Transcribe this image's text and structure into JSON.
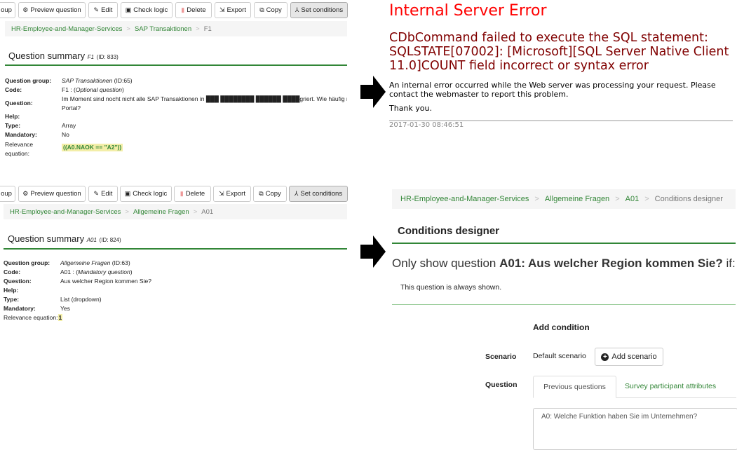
{
  "toolbar": {
    "group": "oup",
    "preview": "Preview question",
    "edit": "Edit",
    "check": "Check logic",
    "delete": "Delete",
    "export": "Export",
    "copy": "Copy",
    "set_conditions": "Set conditions"
  },
  "panel1": {
    "breadcrumb": [
      "HR-Employee-and-Manager-Services",
      "SAP Transaktionen",
      "F1"
    ],
    "title": "Question summary",
    "code": "F1",
    "id": "(ID: 833)",
    "rows": [
      {
        "label": "Question group:",
        "value": "SAP Transaktionen",
        "extra": " (ID:65)"
      },
      {
        "label": "Code:",
        "value": "F1 : (",
        "extra": "Optional question",
        "tail": ")"
      },
      {
        "label": "Question:",
        "value": "Im Moment sind nocht nicht alle SAP Transaktionen in ███ ████████ ██████ ████griert. Wie häufig nu",
        "line2": "Portal?"
      },
      {
        "label": "Help:",
        "value": ""
      },
      {
        "label": "Type:",
        "value": "Array"
      },
      {
        "label": "Mandatory:",
        "value": "No"
      },
      {
        "label": "Relevance equation:",
        "value": "((A0.NAOK == \"A2\"))"
      }
    ]
  },
  "panel2": {
    "breadcrumb": [
      "HR-Employee-and-Manager-Services",
      "Allgemeine Fragen",
      "A01"
    ],
    "title": "Question summary",
    "code": "A01",
    "id": "(ID: 824)",
    "rows": [
      {
        "label": "Question group:",
        "value": "Allgemeine Fragen",
        "extra": " (ID:63)"
      },
      {
        "label": "Code:",
        "value": "A01 : (",
        "extra": "Mandatory question",
        "tail": ")"
      },
      {
        "label": "Question:",
        "value": "Aus welcher Region kommen Sie?"
      },
      {
        "label": "Help:",
        "value": ""
      },
      {
        "label": "Type:",
        "value": "List (dropdown)"
      },
      {
        "label": "Mandatory:",
        "value": "Yes"
      },
      {
        "label": "Relevance equation:",
        "value": "1"
      }
    ]
  },
  "error": {
    "title": "Internal Server Error",
    "message": "CDbCommand failed to execute the SQL statement: SQLSTATE[07002]: [Microsoft][SQL Server Native Client 11.0]COUNT field incorrect or syntax error",
    "body": "An internal error occurred while the Web server was processing your request. Please contact the webmaster to report this problem.",
    "thanks": "Thank you.",
    "timestamp": "2017-01-30 08:46:51"
  },
  "designer": {
    "breadcrumb": [
      "HR-Employee-and-Manager-Services",
      "Allgemeine Fragen",
      "A01",
      "Conditions designer"
    ],
    "title": "Conditions designer",
    "only_show_prefix": "Only show question ",
    "only_show_question": "A01: Aus welcher Region kommen Sie?",
    "only_show_suffix": " if:",
    "always_shown": "This question is always shown.",
    "add_condition": "Add condition",
    "scenario_label": "Scenario",
    "scenario_value": "Default scenario",
    "add_scenario": "Add scenario",
    "question_label": "Question",
    "tabs": [
      "Previous questions",
      "Survey participant attributes"
    ],
    "question_list": [
      "A0: Welche Funktion haben Sie im Unternehmen?"
    ]
  },
  "colors": {
    "green": "#328637",
    "error_red": "#ff0000",
    "error_dark": "#800000"
  }
}
